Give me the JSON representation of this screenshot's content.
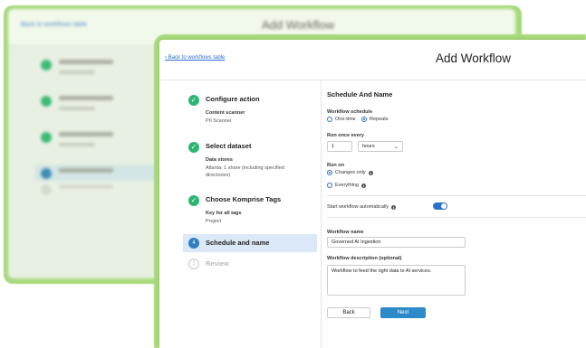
{
  "back_window": {
    "link": "Back to workflows table",
    "title": "Add Workflow"
  },
  "header": {
    "back_link": "Back to workflows table",
    "title": "Add Workflow"
  },
  "stepper": {
    "steps": [
      {
        "label": "Configure action",
        "status": "done",
        "details": [
          {
            "key": "Content scanner",
            "value": "PII Scanner"
          }
        ]
      },
      {
        "label": "Select dataset",
        "status": "done",
        "details": [
          {
            "key": "Data stores",
            "value": "Atlanta: 1 share (including specified directories)"
          }
        ]
      },
      {
        "label": "Choose Komprise Tags",
        "status": "done",
        "details": [
          {
            "key": "Key for all tags",
            "value": "Project"
          }
        ]
      },
      {
        "label": "Schedule and name",
        "status": "active",
        "number": "4"
      },
      {
        "label": "Review",
        "status": "pending",
        "number": "5"
      }
    ]
  },
  "form": {
    "section_title": "Schedule And Name",
    "schedule_label": "Workflow schedule",
    "schedule_options": [
      "One-time",
      "Repeats"
    ],
    "schedule_selected": "Repeats",
    "run_every_label": "Run once every",
    "run_every_value": "1",
    "run_every_unit": "hours",
    "run_on_label": "Run on",
    "run_on_options": [
      "Changes only",
      "Everything"
    ],
    "run_on_selected": "Changes only",
    "auto_start_label": "Start workflow automatically",
    "auto_start_enabled": true,
    "name_label": "Workflow name",
    "name_value": "Governed AI Ingestion",
    "desc_label": "Workflow description (optional)",
    "desc_value": "Workflow to feed the right data to AI services.",
    "back_button": "Back",
    "next_button": "Next"
  },
  "colors": {
    "frame_green": "#a7d97a",
    "done_green": "#2bb673",
    "accent_blue": "#2c6fd1",
    "active_step_bg": "#dbe8f7",
    "next_button": "#2c8ac9"
  },
  "icons": {
    "check": "check-icon",
    "info": "info-icon",
    "chevron": "chevron-down-icon"
  }
}
